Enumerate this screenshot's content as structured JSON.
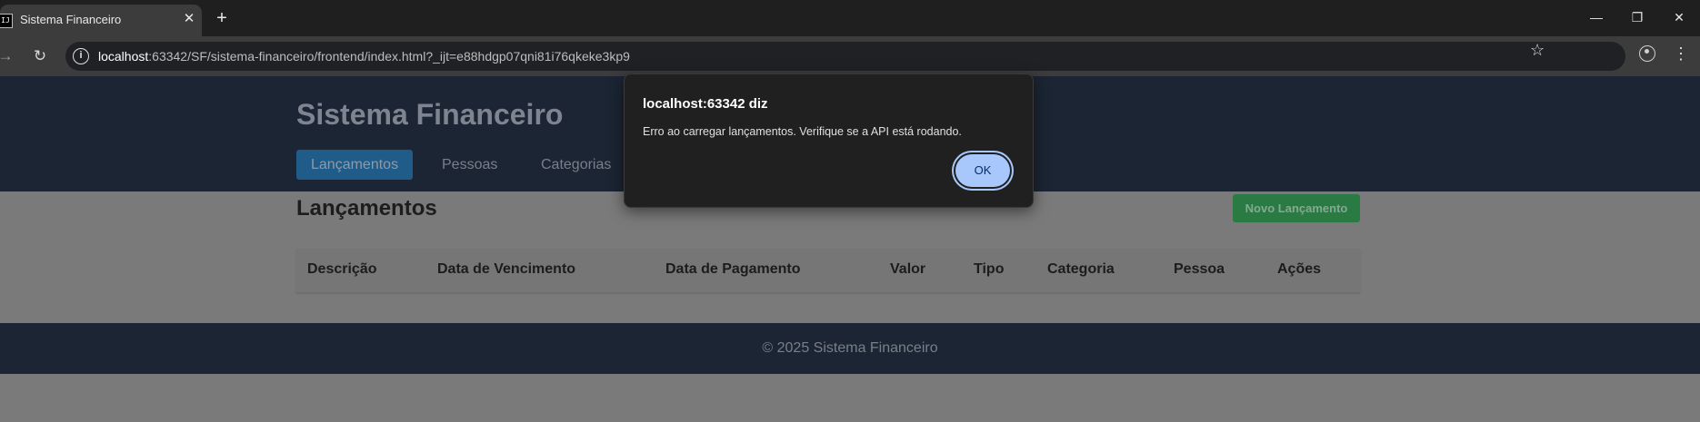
{
  "browser": {
    "tab_title": "Sistema Financeiro",
    "favicon_text": "IJ",
    "url_host": "localhost",
    "url_rest": ":63342/SF/sistema-financeiro/frontend/index.html?_ijt=e88hdgp07qni81i76qkeke3kp9"
  },
  "header": {
    "title": "Sistema Financeiro",
    "nav": [
      "Lançamentos",
      "Pessoas",
      "Categorias"
    ],
    "active_nav": "Lançamentos"
  },
  "main": {
    "section_title": "Lançamentos",
    "new_button": "Novo Lançamento",
    "table_headers": [
      "Descrição",
      "Data de Vencimento",
      "Data de Pagamento",
      "Valor",
      "Tipo",
      "Categoria",
      "Pessoa",
      "Ações"
    ]
  },
  "footer": {
    "text": "© 2025 Sistema Financeiro"
  },
  "dialog": {
    "title": "localhost:63342 diz",
    "message": "Erro ao carregar lançamentos. Verifique se a API está rodando.",
    "ok_label": "OK"
  }
}
